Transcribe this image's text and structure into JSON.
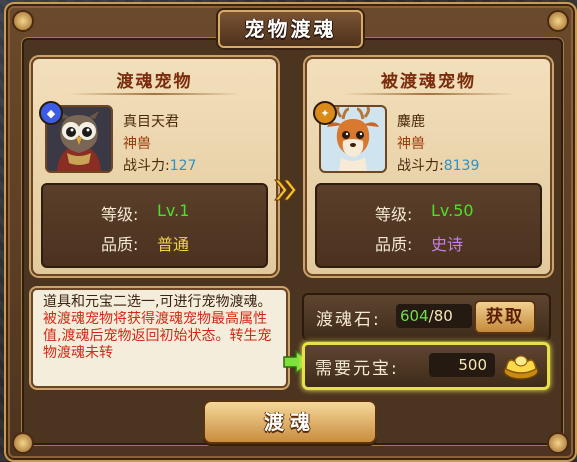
{
  "window": {
    "title": "宠物渡魂"
  },
  "source_pet": {
    "header": "渡魂宠物",
    "name": "真目天君",
    "rank": "神兽",
    "power_label": "战斗力:",
    "power_value": "127",
    "level_label": "等级:",
    "level_value": "Lv.1",
    "quality_label": "品质:",
    "quality_value": "普通",
    "badge_color": "#3d5ce6",
    "portrait_icon": "owl-pet-icon"
  },
  "target_pet": {
    "header": "被渡魂宠物",
    "name": "麋鹿",
    "rank": "神兽",
    "power_label": "战斗力:",
    "power_value": "8139",
    "level_label": "等级:",
    "level_value": "Lv.50",
    "quality_label": "品质:",
    "quality_value": "史诗",
    "badge_color": "#d98a18",
    "portrait_icon": "deer-pet-icon"
  },
  "description": {
    "normal_1": "道具和元宝二选一,可进行宠物渡魂。",
    "red_1": "被渡魂宠物将获得渡魂宠物最高属性值,渡魂后宠物返回初始状态。转生宠物渡魂未转"
  },
  "soul_stone": {
    "label": "渡魂石:",
    "current": "604",
    "required": "/80",
    "get_button": "获取"
  },
  "ingot_cost": {
    "label": "需要元宝:",
    "value": "500"
  },
  "action_button": "渡魂",
  "colors": {
    "level_green": "#4de02b",
    "quality_normal": "#f2d24a",
    "quality_epic": "#c77ff0",
    "highlight_yellow": "#e7e046"
  }
}
